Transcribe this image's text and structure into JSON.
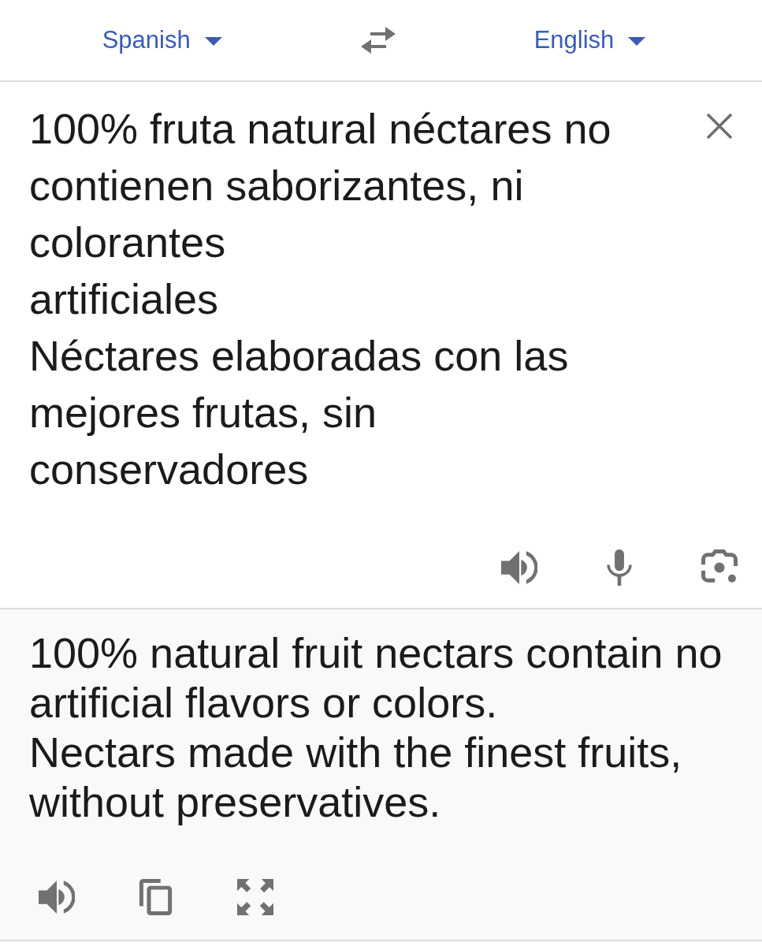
{
  "language_bar": {
    "source_language": "Spanish",
    "target_language": "English"
  },
  "source": {
    "text": "100% fruta natural néctares no\ncontienen saborizantes, ni\ncolorantes\nartificiales\nNéctares elaboradas con las\nmejores frutas, sin\nconservadores"
  },
  "translation": {
    "text": "100% natural fruit nectars contain no\nartificial flavors or colors.\nNectars made with the finest fruits,\nwithout preservatives."
  }
}
